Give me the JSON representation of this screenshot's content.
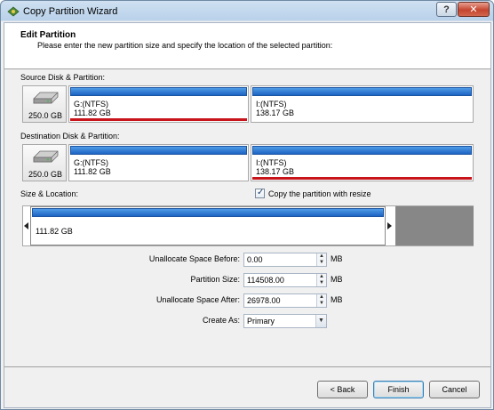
{
  "window": {
    "title": "Copy Partition Wizard",
    "help_label": "?",
    "close_label": "✕"
  },
  "header": {
    "title": "Edit Partition",
    "subtitle": "Please enter the new partition size and specify the location of the selected partition:"
  },
  "source": {
    "label": "Source Disk & Partition:",
    "disk_size": "250.0 GB",
    "partitions": [
      {
        "name": "G:(NTFS)",
        "size": "111.82 GB",
        "selected": true
      },
      {
        "name": "I:(NTFS)",
        "size": "138.17 GB",
        "selected": false
      }
    ]
  },
  "destination": {
    "label": "Destination Disk & Partition:",
    "disk_size": "250.0 GB",
    "partitions": [
      {
        "name": "G:(NTFS)",
        "size": "111.82 GB",
        "selected": false
      },
      {
        "name": "I:(NTFS)",
        "size": "138.17 GB",
        "selected": true
      }
    ]
  },
  "size_location": {
    "label": "Size & Location:",
    "resize_checkbox_label": "Copy the partition with resize",
    "resize_checked": true,
    "partition_size_text": "111.82 GB"
  },
  "fields": {
    "unallocate_before": {
      "label": "Unallocate Space Before:",
      "value": "0.00",
      "unit": "MB"
    },
    "partition_size": {
      "label": "Partition Size:",
      "value": "114508.00",
      "unit": "MB"
    },
    "unallocate_after": {
      "label": "Unallocate Space After:",
      "value": "26978.00",
      "unit": "MB"
    },
    "create_as": {
      "label": "Create As:",
      "value": "Primary"
    }
  },
  "buttons": {
    "back": "< Back",
    "finish": "Finish",
    "cancel": "Cancel"
  },
  "colors": {
    "partition_bar": "#1d64c4",
    "selected_marker": "#c8151b",
    "unallocated": "#878787"
  }
}
